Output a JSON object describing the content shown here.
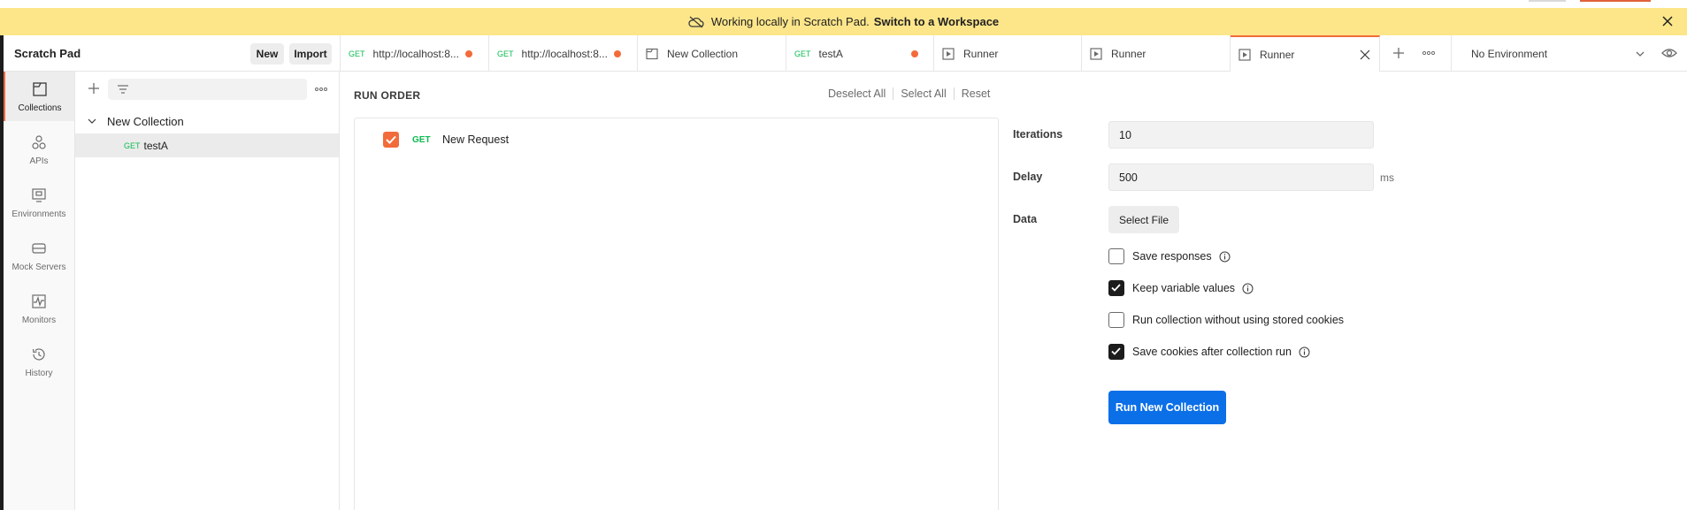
{
  "banner": {
    "text": "Working locally in Scratch Pad.",
    "link": "Switch to a Workspace"
  },
  "header": {
    "workspace_title": "Scratch Pad",
    "new_label": "New",
    "import_label": "Import"
  },
  "tabs": [
    {
      "method": "GET",
      "label": "http://localhost:8...",
      "unsaved": true
    },
    {
      "method": "GET",
      "label": "http://localhost:8...",
      "unsaved": true
    },
    {
      "icon": "collection-icon",
      "label": "New Collection"
    },
    {
      "method": "GET",
      "label": "testA",
      "unsaved": true
    },
    {
      "icon": "runner-icon",
      "label": "Runner"
    },
    {
      "icon": "runner-icon",
      "label": "Runner"
    },
    {
      "icon": "runner-icon",
      "label": "Runner",
      "active": true
    }
  ],
  "environment": {
    "selected": "No Environment"
  },
  "rail": [
    {
      "label": "Collections",
      "icon": "collections-icon",
      "active": true
    },
    {
      "label": "APIs",
      "icon": "apis-icon"
    },
    {
      "label": "Environments",
      "icon": "environments-icon"
    },
    {
      "label": "Mock Servers",
      "icon": "mock-servers-icon"
    },
    {
      "label": "Monitors",
      "icon": "monitors-icon"
    },
    {
      "label": "History",
      "icon": "history-icon"
    }
  ],
  "sidebar": {
    "search_placeholder": "",
    "collection": "New Collection",
    "request": {
      "method": "GET",
      "name": "testA"
    }
  },
  "runner": {
    "run_order_title": "RUN ORDER",
    "deselect_all": "Deselect All",
    "select_all": "Select All",
    "reset": "Reset",
    "items": [
      {
        "method": "GET",
        "name": "New Request",
        "checked": true
      }
    ]
  },
  "settings": {
    "iterations_label": "Iterations",
    "iterations_value": "10",
    "delay_label": "Delay",
    "delay_value": "500",
    "delay_unit": "ms",
    "data_label": "Data",
    "select_file": "Select File",
    "options": [
      {
        "label": "Save responses",
        "checked": false,
        "info": true
      },
      {
        "label": "Keep variable values",
        "checked": true,
        "info": true
      },
      {
        "label": "Run collection without using stored cookies",
        "checked": false,
        "info": false
      },
      {
        "label": "Save cookies after collection run",
        "checked": true,
        "info": true
      }
    ],
    "run_button": "Run New Collection"
  },
  "colors": {
    "accent": "#f26b3a",
    "primary_button": "#0b6fe8",
    "banner": "#fde68a",
    "method_get": "#0cbb52"
  }
}
